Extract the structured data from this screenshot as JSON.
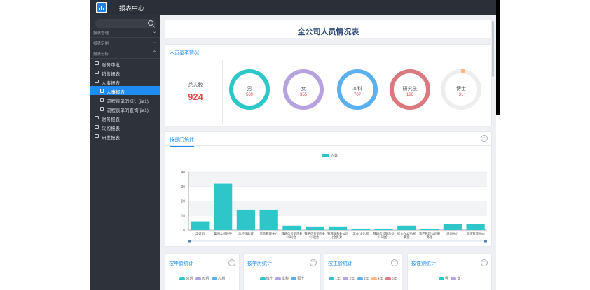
{
  "app": {
    "title": "报表中心"
  },
  "sidebar": {
    "search": {
      "placeholder": ""
    },
    "groups": [
      {
        "label": "报表管理",
        "expanded": false
      },
      {
        "label": "报表定制",
        "expanded": false
      },
      {
        "label": "报表分析",
        "expanded": true
      }
    ],
    "items": [
      {
        "label": "财务审批"
      },
      {
        "label": "销售报表"
      },
      {
        "label": "人事报表"
      },
      {
        "label": "人事报表"
      },
      {
        "label": "流程表单的统计(jia1)"
      },
      {
        "label": "流程表单的查询(jia1)"
      },
      {
        "label": "财务报表"
      },
      {
        "label": "采购报表"
      },
      {
        "label": "研发报表"
      }
    ]
  },
  "main": {
    "title": "全公司人员情况表",
    "basic": {
      "section_label": "人员基本情况",
      "total_label": "总人数",
      "total_value": "924",
      "stats": [
        {
          "label": "男",
          "value": "569",
          "color": "#2ec7c9"
        },
        {
          "label": "女",
          "value": "355",
          "color": "#b6a2de"
        },
        {
          "label": "本科",
          "value": "707",
          "color": "#5ab1ef"
        },
        {
          "label": "研究生",
          "value": "186",
          "color": "#d87a80"
        },
        {
          "label": "博士",
          "value": "31",
          "color": "#ffb980",
          "fraction": 0.034
        }
      ]
    },
    "dept": {
      "section_label": "按部门统计",
      "more": "···"
    },
    "bottom_cards": [
      {
        "label": "按年龄统计",
        "more": "···",
        "legend": [
          {
            "name": "80后",
            "color": "#2ec7c9"
          },
          {
            "name": "90后",
            "color": "#b6a2de"
          },
          {
            "name": "70后",
            "color": "#5ab1ef"
          }
        ]
      },
      {
        "label": "按学历统计",
        "more": "···",
        "legend": [
          {
            "name": "博士",
            "color": "#2ec7c9"
          },
          {
            "name": "本科",
            "color": "#b6a2de"
          },
          {
            "name": "硕士",
            "color": "#5ab1ef"
          }
        ]
      },
      {
        "label": "按工龄统计",
        "more": "···",
        "legend": [
          {
            "name": "1年",
            "color": "#2ec7c9"
          },
          {
            "name": "2年",
            "color": "#b6a2de"
          },
          {
            "name": "3年",
            "color": "#5ab1ef"
          },
          {
            "name": "4年",
            "color": "#ffb980"
          },
          {
            "name": "5年",
            "color": "#d87a80"
          }
        ]
      },
      {
        "label": "按性别统计",
        "more": "···",
        "legend": [
          {
            "name": "男",
            "color": "#2ec7c9"
          },
          {
            "name": "女",
            "color": "#b6a2de"
          }
        ]
      }
    ]
  },
  "chart_data": {
    "type": "bar",
    "legend": [
      "人数"
    ],
    "series": [
      {
        "name": "人数",
        "values": [
          6,
          32,
          14,
          14,
          3,
          2,
          2,
          1,
          1,
          3,
          1,
          4,
          4
        ]
      }
    ],
    "categories": [
      "华盛司",
      "集团公司领导",
      "总经理助理",
      "信息管理中心",
      "铁路信号销售处公司(合...",
      "铁路信号销售处公司(合...",
      "管理联系处公司(合资源...",
      "工会/文化部",
      "铁路信号销售处公司(合...",
      "综合办公室/机要室",
      "资产管理公司服务组",
      "培训中心",
      "资金管理中心"
    ],
    "ylim": [
      0,
      40
    ],
    "yticks": [
      0,
      10,
      20,
      30,
      40
    ],
    "color": "#2ec7c9",
    "legend_position": "top-center",
    "grid": true
  }
}
